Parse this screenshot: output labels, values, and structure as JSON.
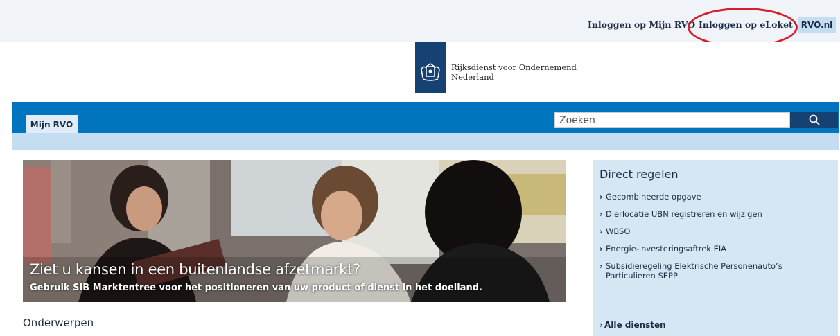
{
  "topbar": {
    "links": [
      "Inloggen op Mijn RVO",
      "Inloggen op eLoket",
      "RVO.nl"
    ]
  },
  "logo": {
    "line1": "Rijksdienst voor Ondernemend",
    "line2": "Nederland"
  },
  "nav": {
    "tab_label": "Mijn RVO"
  },
  "search": {
    "placeholder": "Zoeken",
    "icon": "search-icon"
  },
  "banner": {
    "title": "Ziet u kansen in een buitenlandse afzetmarkt?",
    "subtitle": "Gebruik SIB Marktentree voor het positioneren van uw product of dienst in het doelland."
  },
  "main": {
    "section_title": "Onderwerpen"
  },
  "direct_regelen": {
    "title": "Direct regelen",
    "items": [
      "Gecombineerde opgave",
      "Dierlocatie UBN registreren en wijzigen",
      "WBSO",
      "Energie-investeringsaftrek EIA",
      "Subsidieregeling Elektrische Personenauto’s Particulieren SEPP"
    ],
    "all_label": "Alle diensten"
  },
  "colors": {
    "brand_blue": "#154273",
    "nav_blue": "#0074be",
    "light_blue": "#c5ddf0",
    "highlight_red": "#d81e2c"
  }
}
